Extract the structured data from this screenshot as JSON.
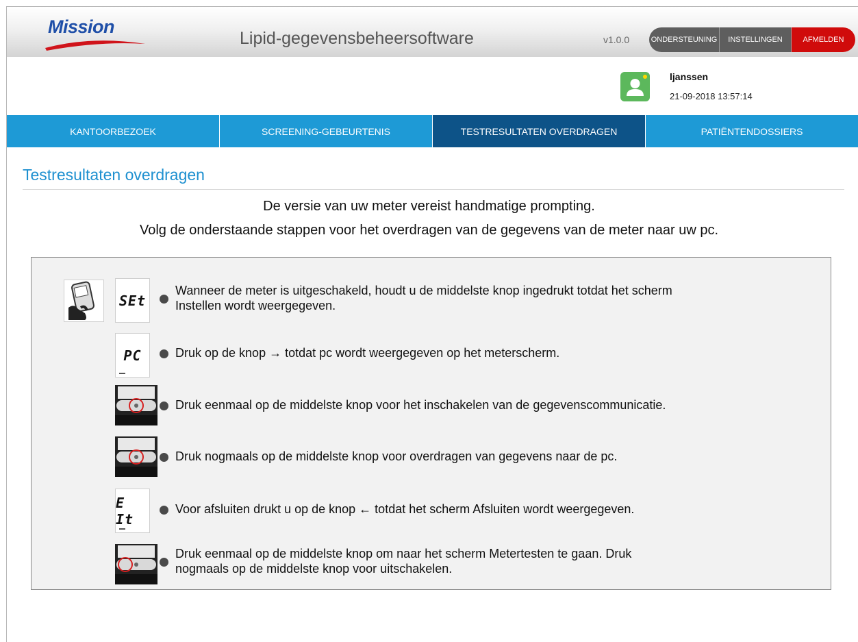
{
  "header": {
    "logo_text": "Mission",
    "app_title": "Lipid-gegevensbeheersoftware",
    "version": "v1.0.0",
    "buttons": {
      "support": "ONDERSTEUNING",
      "settings": "INSTELLINGEN",
      "logout": "AFMELDEN"
    }
  },
  "user": {
    "name": "ljanssen",
    "datetime": "21-09-2018 13:57:14"
  },
  "nav": {
    "tabs": [
      {
        "label": "KANTOORBEZOEK",
        "active": false
      },
      {
        "label": "SCREENING-GEBEURTENIS",
        "active": false
      },
      {
        "label": "TESTRESULTATEN OVERDRAGEN",
        "active": true
      },
      {
        "label": "PATIËNTENDOSSIERS",
        "active": false
      }
    ]
  },
  "page": {
    "title": "Testresultaten overdragen",
    "intro_line1": "De versie van uw meter vereist handmatige prompting.",
    "intro_line2": "Volg de onderstaande stappen voor het overdragen van de gegevens van de meter naar uw pc."
  },
  "steps": [
    {
      "display": "SEt",
      "icon": "meter-hand-icon",
      "text_line1": "Wanneer de meter is uitgeschakeld, houdt u de middelste knop ingedrukt totdat het scherm",
      "text_line2": "Instellen wordt weergegeven."
    },
    {
      "display": "PC",
      "text_line1": "Druk op de knop → totdat pc wordt weergegeven op het meterscherm."
    },
    {
      "icon": "meter-middle-button-icon",
      "text_line1": "Druk eenmaal op de middelste knop voor het inschakelen van de gegevenscommunicatie."
    },
    {
      "icon": "meter-middle-button-icon",
      "text_line1": "Druk nogmaals op de middelste knop voor overdragen van gegevens naar de pc."
    },
    {
      "display": "E It",
      "text_line1": "Voor afsluiten drukt u op de knop ← totdat het scherm Afsluiten wordt weergegeven."
    },
    {
      "icon": "meter-left-button-icon",
      "text_line1": "Druk eenmaal op de middelste knop om naar het scherm Metertesten te gaan. Druk",
      "text_line2": "nogmaals op de middelste knop voor uitschakelen."
    }
  ],
  "colors": {
    "accent": "#1e9ad6",
    "active_tab": "#0d5388",
    "logout": "#d00b0b",
    "avatar": "#5cb85c",
    "title": "#1e90d0"
  }
}
